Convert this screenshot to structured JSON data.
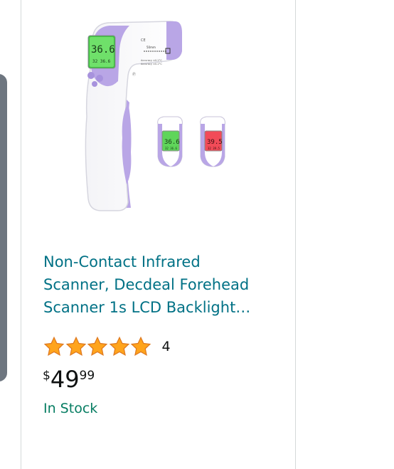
{
  "product": {
    "title_lines": [
      "Non-Contact Infrared",
      "Scanner, Decdeal Forehead",
      "Scanner 1s LCD Backlight…"
    ],
    "rating": 5,
    "rating_count": "4",
    "price": {
      "symbol": "$",
      "whole": "49",
      "fraction": "99"
    },
    "availability": "In Stock",
    "image_icon": "infrared-thermometer-image",
    "display_readings": [
      "36.6",
      "36.6",
      "39.5"
    ]
  },
  "colors": {
    "link": "#007185",
    "in_stock": "#067d62",
    "star": "#ffa41c",
    "border": "#d5d9d9",
    "side_tab": "#6e7680",
    "device_purple": "#b9a6e6"
  }
}
